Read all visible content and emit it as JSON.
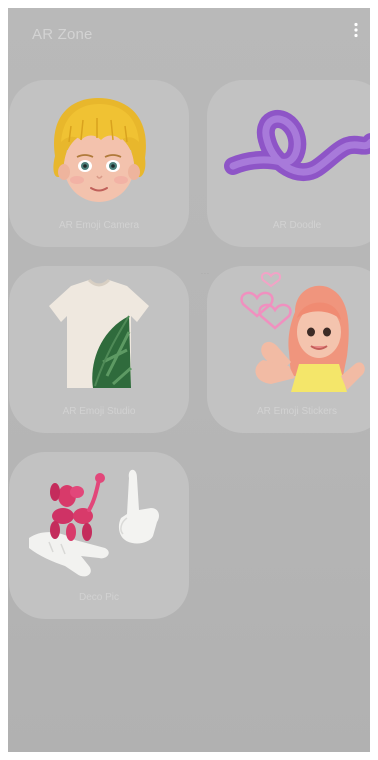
{
  "header": {
    "title": "AR Zone",
    "more_icon": "more-vertical-icon"
  },
  "tiles": [
    {
      "label": "AR Emoji Camera",
      "icon": "emoji-face-icon"
    },
    {
      "label": "AR Doodle",
      "icon": "doodle-squiggle-icon"
    },
    {
      "label": "AR Emoji Studio",
      "icon": "tshirt-icon"
    },
    {
      "label": "AR Emoji Stickers",
      "icon": "emoji-sticker-icon"
    },
    {
      "label": "Deco Pic",
      "icon": "deco-pic-icon"
    }
  ],
  "colors": {
    "background": "#b6b6b6",
    "tile": "#c2c2c2",
    "label_text": "#d2d2d2"
  }
}
